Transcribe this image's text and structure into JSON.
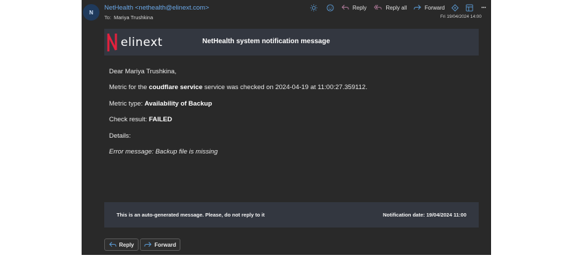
{
  "email": {
    "avatar_initial": "N",
    "sender": "NetHealth <nethealth@elinext.com>",
    "to_label": "To:",
    "to_name": "Mariya Trushkina",
    "date": "Fri 19/04/2024 14:00"
  },
  "toolbar": {
    "reply": "Reply",
    "reply_all": "Reply all",
    "forward": "Forward",
    "more": "···"
  },
  "message": {
    "logo_text": "elinext",
    "title": "NetHealth system notification message",
    "greeting": "Dear Mariya Trushkina,",
    "metric_prefix": "Metric for the",
    "service_name": "coudflare service",
    "metric_suffix": "service was checked on 2024-04-19 at 11:00:27.359112.",
    "metric_type_label": "Metric type:",
    "metric_type_value": "Availability of Backup",
    "check_result_label": "Check result:",
    "check_result_value": "FAILED",
    "details_label": "Details:",
    "error_message": "Error message: Backup file is missing",
    "footer_left": "This is an auto-generated message. Please, do not reply to it",
    "footer_right": "Notification date: 19/04/2024 11:00"
  },
  "actions": {
    "reply": "Reply",
    "forward": "Forward"
  },
  "colors": {
    "background": "#292929",
    "band": "#333740",
    "sender_link": "#6aa8e8",
    "toolbar_icon_accent": "#5b9bd5",
    "logo_accent": "#e4213d"
  }
}
